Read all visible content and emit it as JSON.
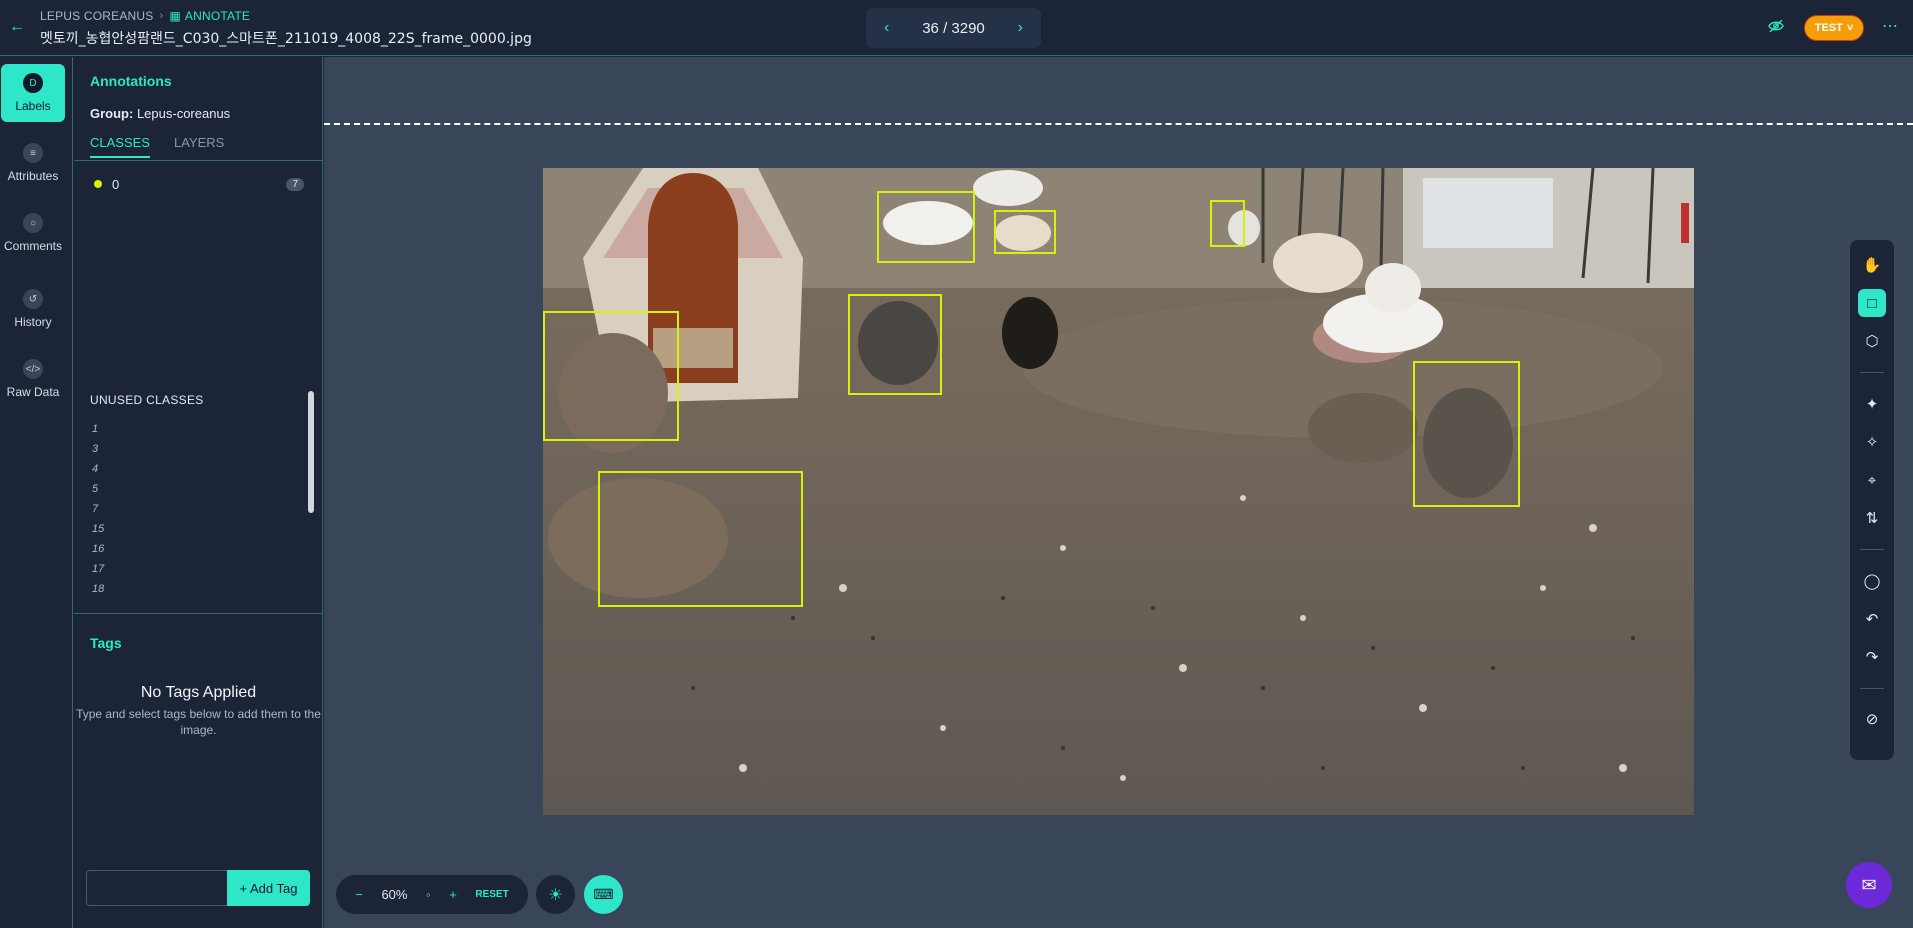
{
  "header": {
    "project": "LEPUS COREANUS",
    "mode": "ANNOTATE",
    "filename": "멧토끼_농협안성팜랜드_C030_스마트폰_211019_4008_22S_frame_0000.jpg",
    "pager": {
      "current": "36 / 3290"
    },
    "user_badge": "TEST"
  },
  "rail": {
    "items": [
      {
        "label": "Labels",
        "icon": "labels-icon"
      },
      {
        "label": "Attributes",
        "icon": "attributes-icon"
      },
      {
        "label": "Comments",
        "icon": "comments-icon"
      },
      {
        "label": "History",
        "icon": "history-icon"
      },
      {
        "label": "Raw Data",
        "icon": "raw-data-icon"
      }
    ]
  },
  "panel": {
    "title": "Annotations",
    "group_label": "Group:",
    "group_value": "Lepus-coreanus",
    "tabs": [
      "CLASSES",
      "LAYERS"
    ],
    "classes": [
      {
        "name": "0",
        "count": "7",
        "color": "#d4f20a"
      }
    ],
    "unused_title": "UNUSED CLASSES",
    "unused": [
      "1",
      "3",
      "4",
      "5",
      "7",
      "15",
      "16",
      "17",
      "18"
    ],
    "tags_title": "Tags",
    "no_tags_heading": "No Tags Applied",
    "no_tags_text": "Type and select tags below to add them to the image.",
    "add_tag_label": "+ Add Tag"
  },
  "zoom": {
    "level": "60%",
    "reset_label": "RESET"
  },
  "colors": {
    "accent": "#2ee6c8",
    "bbox": "#d4f20a",
    "badge": "#f59e0b",
    "chat": "#6d28d9"
  },
  "toolbar": {
    "tools": [
      "pan-hand-icon",
      "bounding-box-icon",
      "polygon-icon",
      "auto-annotate-icon",
      "magic-wand-icon",
      "keypoint-icon",
      "swap-icon",
      "comment-icon",
      "undo-icon",
      "redo-icon",
      "hide-icon"
    ]
  }
}
